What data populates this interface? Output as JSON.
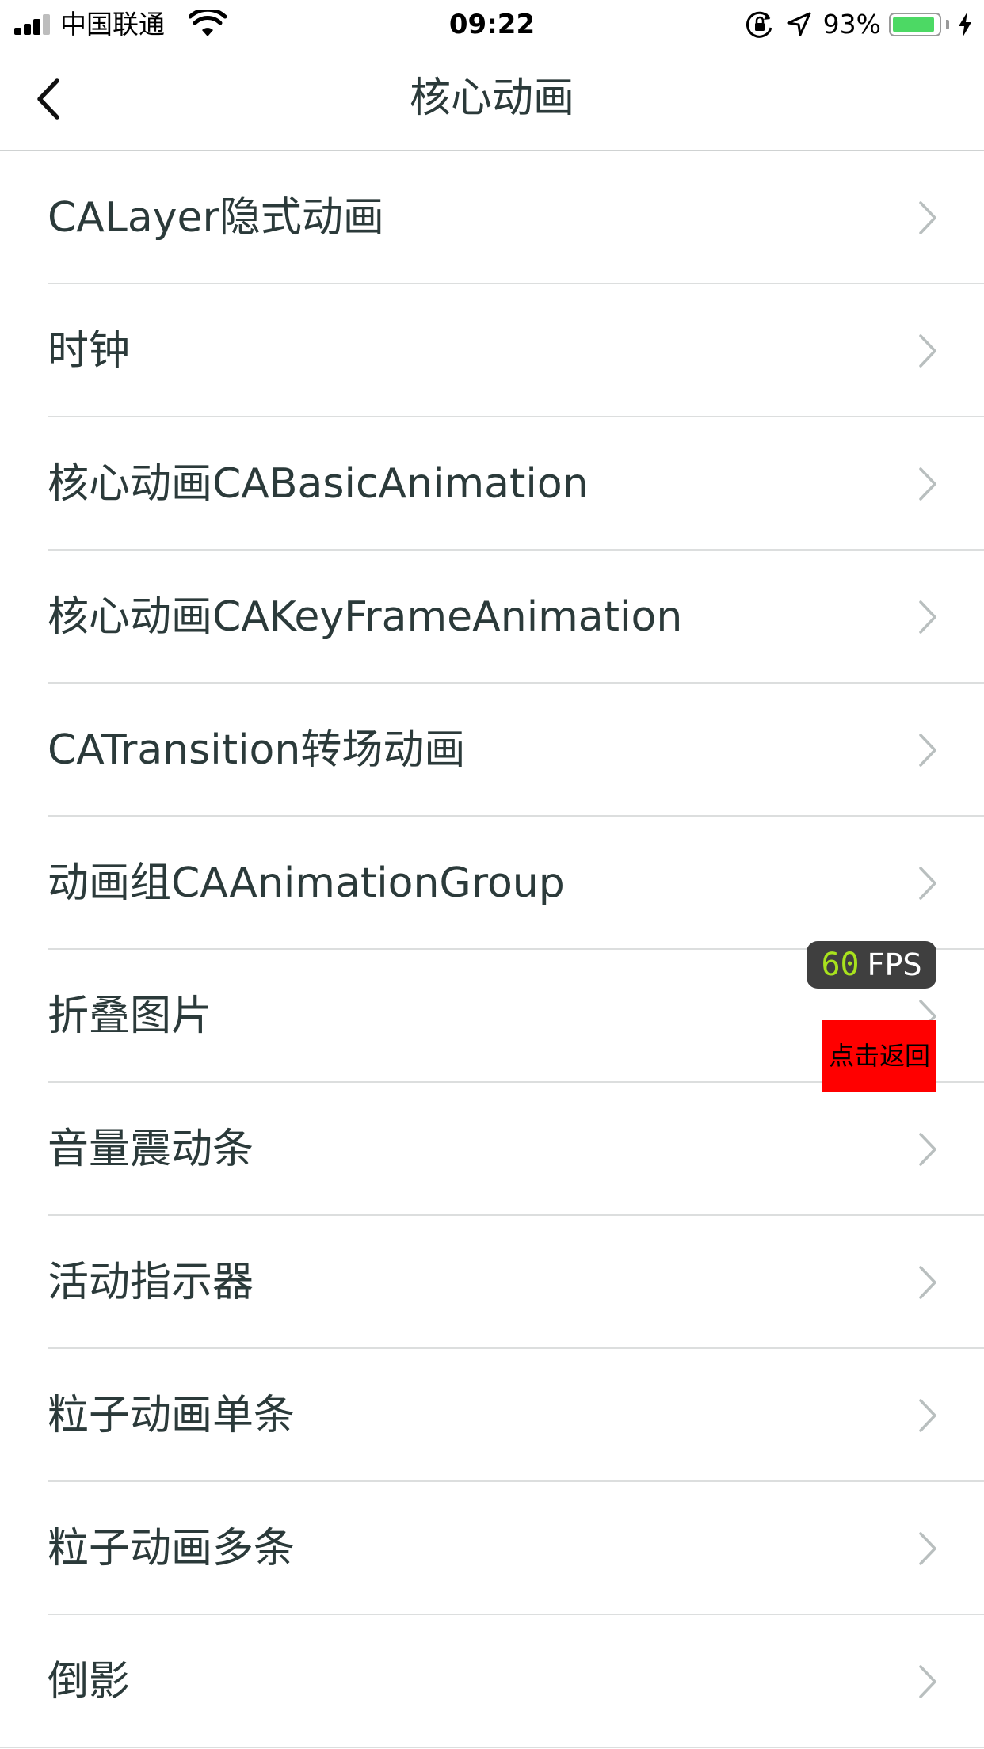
{
  "status_bar": {
    "carrier": "中国联通",
    "time": "09:22",
    "battery_percent_text": "93%",
    "battery_level": 0.93,
    "battery_color": "#4cd964",
    "icons": [
      "signal-icon",
      "wifi-icon",
      "orientation-lock-icon",
      "location-arrow-icon",
      "battery-icon",
      "charging-bolt-icon"
    ]
  },
  "nav": {
    "back_icon": "chevron-left-icon",
    "title": "核心动画"
  },
  "list": {
    "chevron_icon": "chevron-right-icon",
    "items": [
      {
        "label": "CALayer隐式动画"
      },
      {
        "label": "时钟"
      },
      {
        "label": "核心动画CABasicAnimation"
      },
      {
        "label": "核心动画CAKeyFrameAnimation"
      },
      {
        "label": "CATransition转场动画"
      },
      {
        "label": "动画组CAAnimationGroup"
      },
      {
        "label": "折叠图片"
      },
      {
        "label": "音量震动条"
      },
      {
        "label": "活动指示器"
      },
      {
        "label": "粒子动画单条"
      },
      {
        "label": "粒子动画多条"
      },
      {
        "label": "倒影"
      }
    ]
  },
  "fps_badge": {
    "value": "60",
    "unit": "FPS",
    "value_color": "#a8e21d"
  },
  "tap_back_button": {
    "label": "点击返回",
    "background_color": "#ff0000"
  }
}
